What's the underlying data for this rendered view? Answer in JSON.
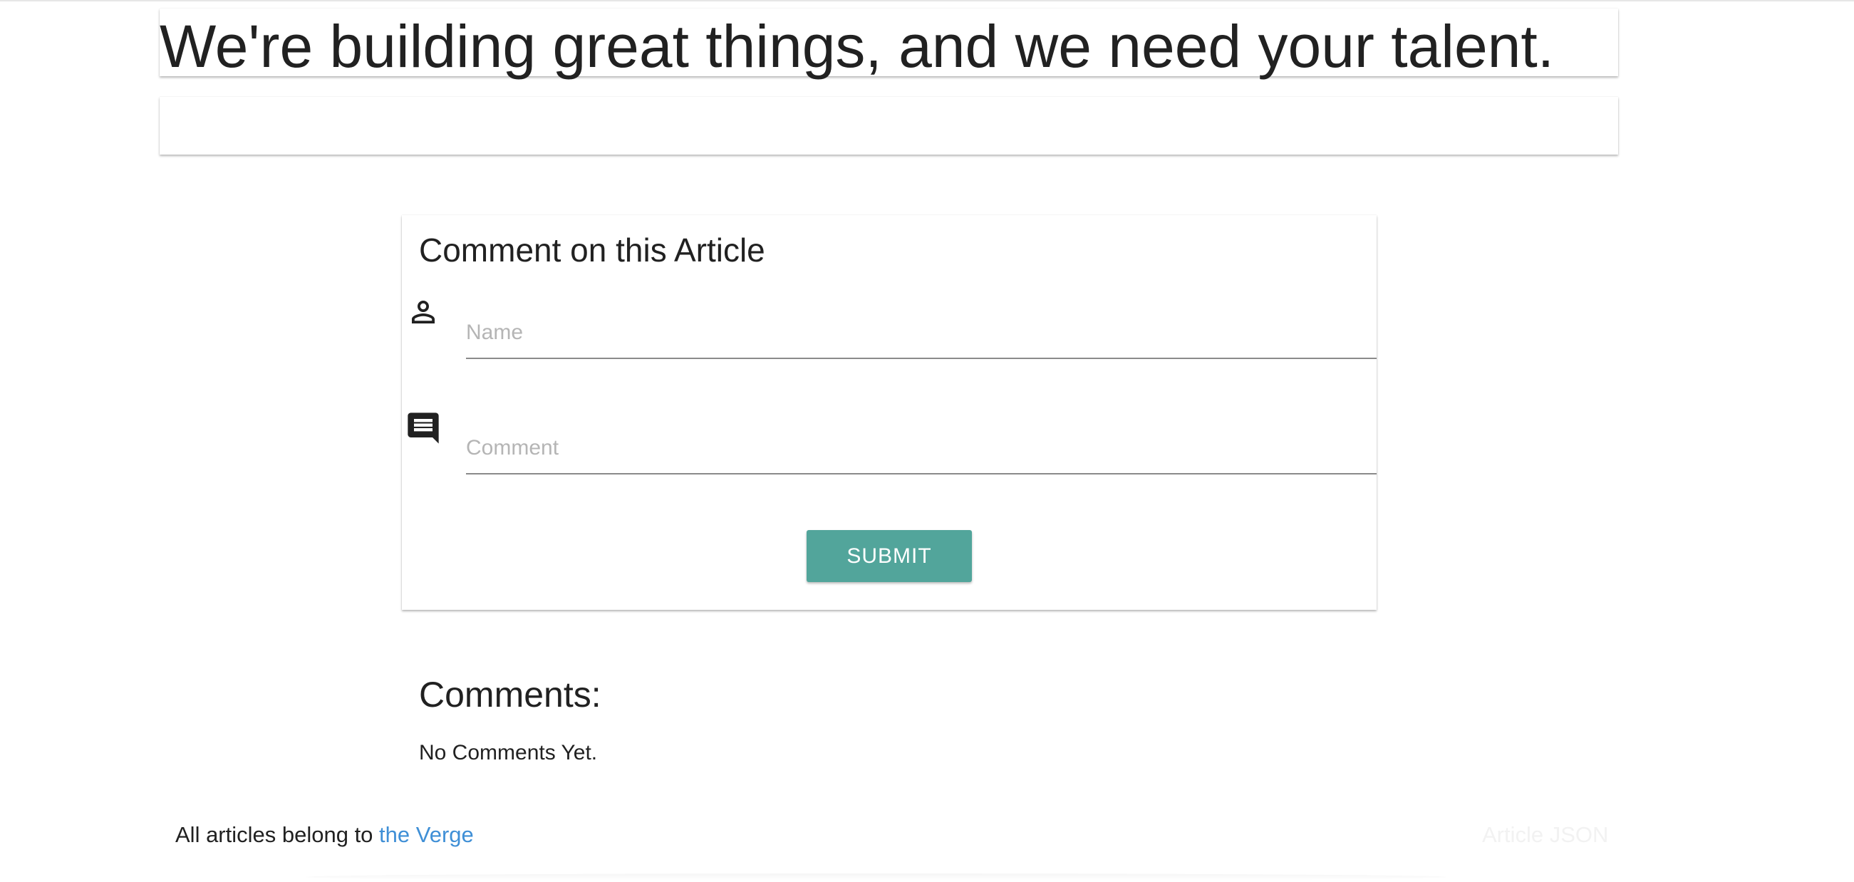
{
  "header": {
    "title": "We're building great things, and we need your talent."
  },
  "comment_form": {
    "title": "Comment on this Article",
    "name_placeholder": "Name",
    "comment_placeholder": "Comment",
    "submit_label": "SUBMIT",
    "person_icon": "person-outline-icon",
    "comment_icon": "comment-icon",
    "submit_color": "#52a59b"
  },
  "comments": {
    "heading": "Comments:",
    "empty_text": "No Comments Yet."
  },
  "footer": {
    "credit_prefix": "All articles belong to ",
    "credit_link": "the Verge",
    "article_json_link": "Article JSON",
    "link_color": "#3f8fd6"
  }
}
